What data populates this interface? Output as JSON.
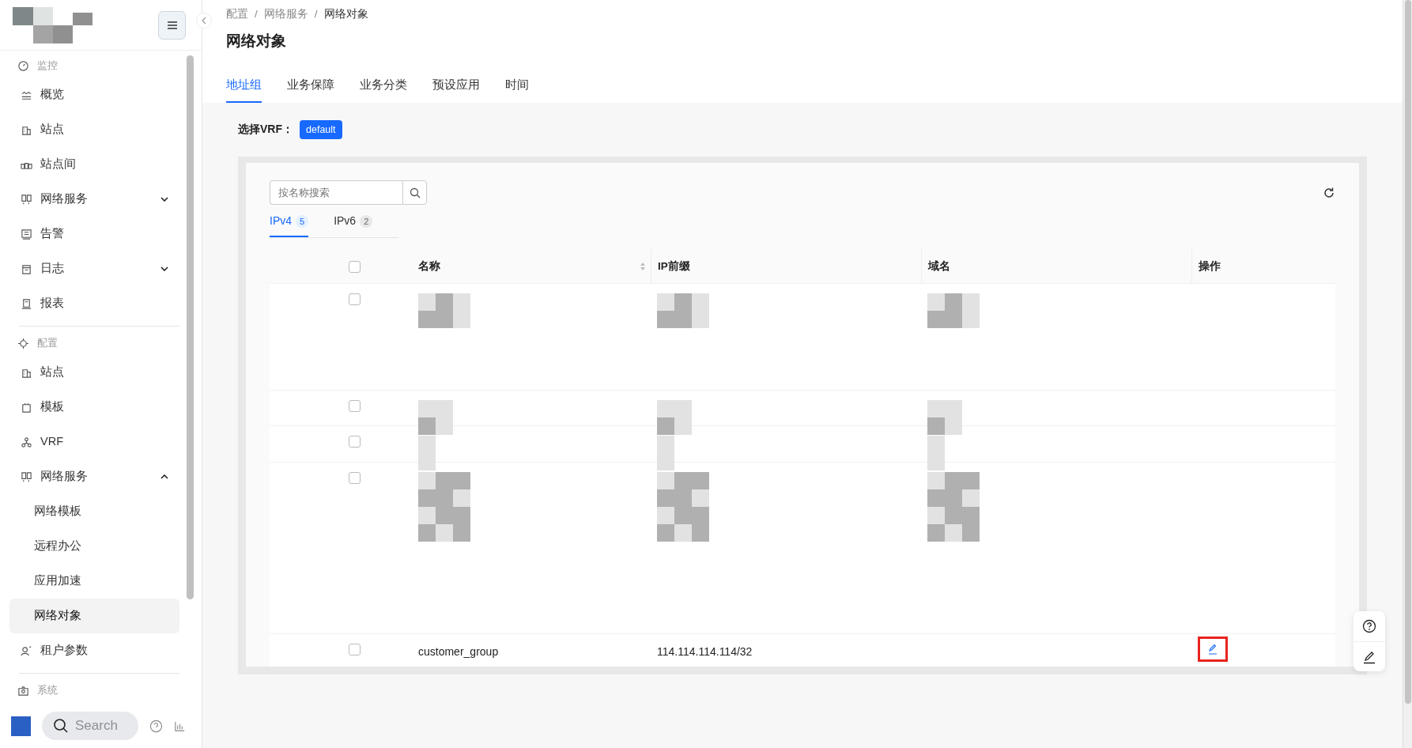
{
  "sidebar": {
    "items": [
      {
        "kind": "section",
        "label": "监控"
      },
      {
        "kind": "item",
        "label": "概览",
        "selected": false
      },
      {
        "kind": "item",
        "label": "站点",
        "selected": false
      },
      {
        "kind": "item",
        "label": "站点间",
        "selected": false
      },
      {
        "kind": "item",
        "label": "网络服务",
        "selected": false,
        "expanded": false
      },
      {
        "kind": "item",
        "label": "告警",
        "selected": false
      },
      {
        "kind": "item",
        "label": "日志",
        "selected": false,
        "expanded": false
      },
      {
        "kind": "item",
        "label": "报表",
        "selected": false
      },
      {
        "kind": "section",
        "label": "配置"
      },
      {
        "kind": "item",
        "label": "站点",
        "selected": false
      },
      {
        "kind": "item",
        "label": "模板",
        "selected": false
      },
      {
        "kind": "item",
        "label": "VRF",
        "selected": false
      },
      {
        "kind": "item",
        "label": "网络服务",
        "selected": false,
        "expanded": true
      },
      {
        "kind": "subitem",
        "label": "网络模板",
        "selected": false
      },
      {
        "kind": "subitem",
        "label": "远程办公",
        "selected": false
      },
      {
        "kind": "subitem",
        "label": "应用加速",
        "selected": false
      },
      {
        "kind": "subitem",
        "label": "网络对象",
        "selected": true
      },
      {
        "kind": "item",
        "label": "租户参数",
        "selected": false
      },
      {
        "kind": "section",
        "label": "系统"
      }
    ]
  },
  "dock": {
    "search_label": "Search"
  },
  "breadcrumb": {
    "separator": "/",
    "items": [
      "配置",
      "网络服务",
      "网络对象"
    ]
  },
  "page_title": "网络对象",
  "tabs": [
    {
      "label": "地址组",
      "selected": true
    },
    {
      "label": "业务保障",
      "selected": false
    },
    {
      "label": "业务分类",
      "selected": false
    },
    {
      "label": "预设应用",
      "selected": false
    },
    {
      "label": "时间",
      "selected": false
    }
  ],
  "vrf": {
    "label": "选择VRF：",
    "value": "default"
  },
  "search": {
    "placeholder": "按名称搜索"
  },
  "ip_tabs": [
    {
      "label": "IPv4",
      "count": "5",
      "selected": true
    },
    {
      "label": "IPv6",
      "count": "2",
      "selected": false
    }
  ],
  "table": {
    "header_checked": false,
    "columns": [
      "名称",
      "IP前缀",
      "域名",
      "操作"
    ],
    "rows": [
      {
        "kind": "redacted",
        "checked": false
      },
      {
        "kind": "redacted",
        "checked": false
      },
      {
        "kind": "redacted",
        "checked": false
      },
      {
        "kind": "redacted",
        "checked": false
      },
      {
        "kind": "data",
        "checked": false,
        "name": "customer_group",
        "ip_prefix": "114.114.114.114/32",
        "highlighted": true
      }
    ]
  }
}
